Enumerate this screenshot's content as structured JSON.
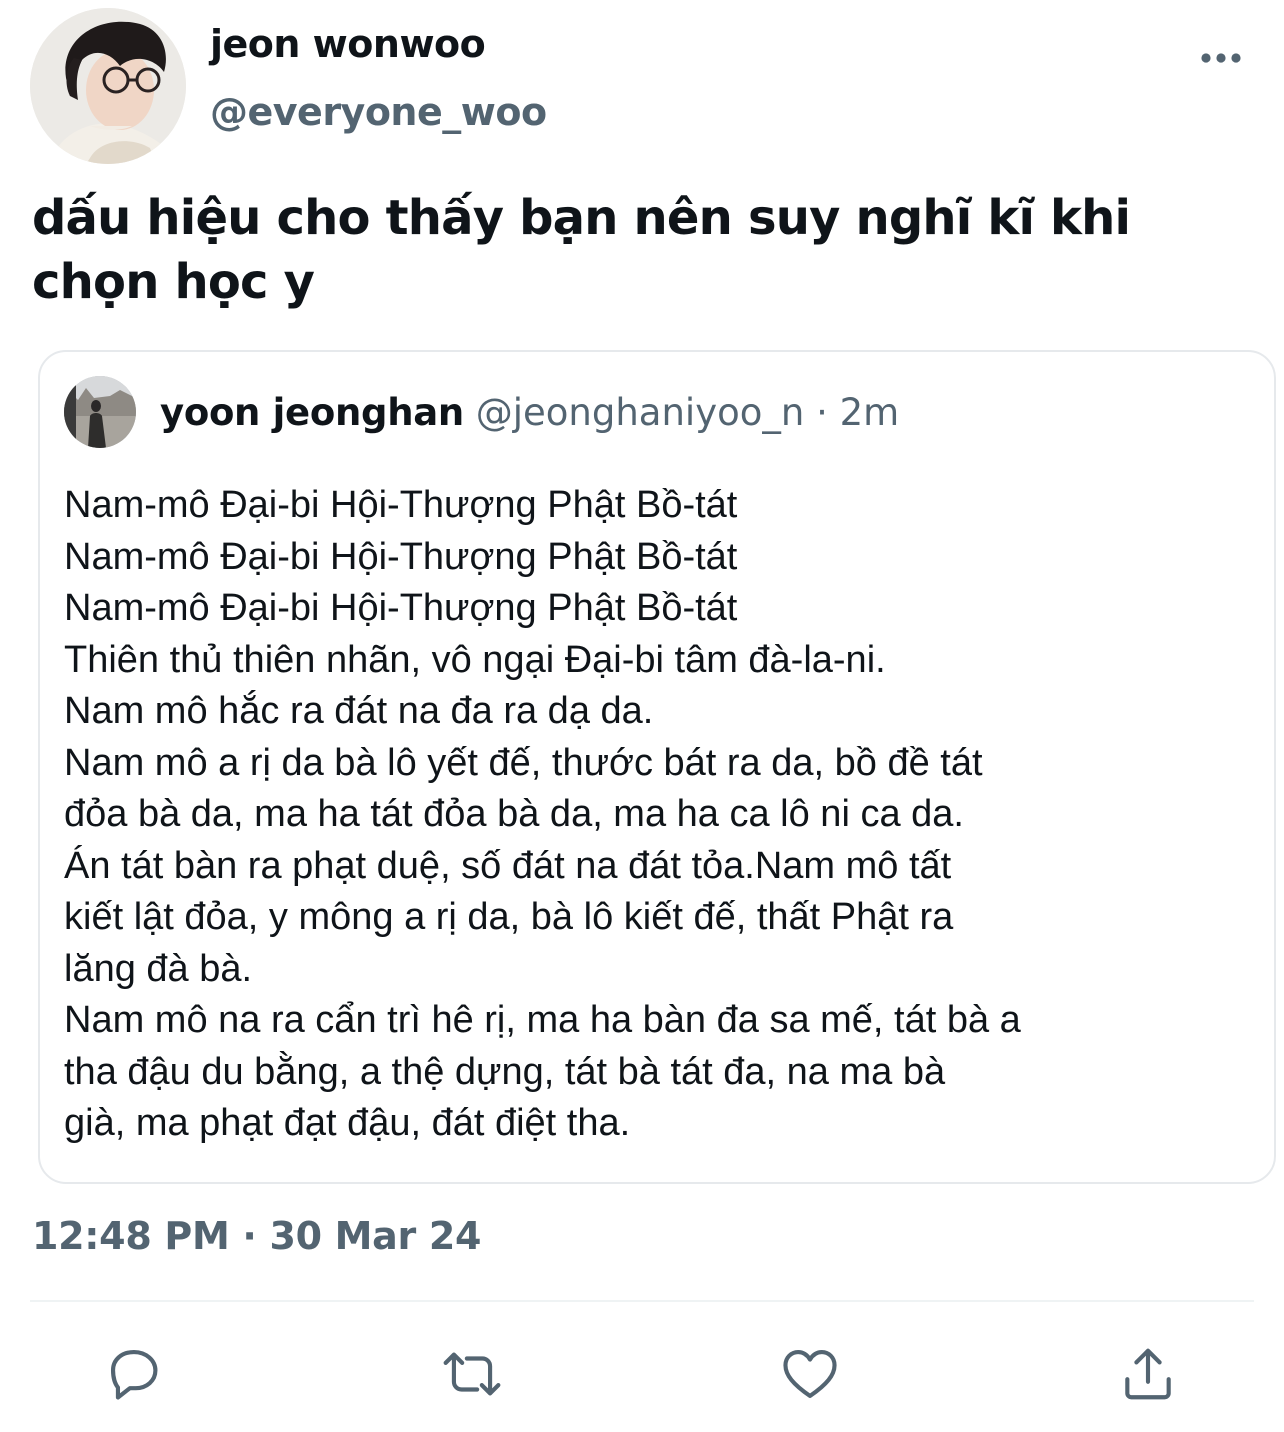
{
  "author": {
    "display_name": "jeon wonwoo",
    "handle": "@everyone_woo"
  },
  "tweet": {
    "text": "dấu hiệu cho thấy bạn nên suy nghĩ kĩ khi chọn học y",
    "timestamp": "12:48 PM · 30 Mar 24"
  },
  "quoted_tweet": {
    "display_name": "yoon jeonghan",
    "handle": "@jeonghaniyoo_n",
    "separator": "·",
    "time": "2m",
    "lines": [
      "Nam-mô Đại-bi Hội-Thượng Phật Bồ-tát",
      "Nam-mô Đại-bi Hội-Thượng Phật Bồ-tát",
      "Nam-mô Đại-bi Hội-Thượng Phật Bồ-tát",
      "Thiên thủ thiên nhãn, vô ngại Đại-bi tâm đà-la-ni.",
      "Nam mô hắc ra đát na đa ra dạ da.",
      "Nam mô a rị da bà lô yết đế, thước bát ra da, bồ đề tát",
      "đỏa bà da, ma ha tát đỏa bà da, ma ha ca lô ni ca da.",
      "Án tát bàn ra phạt duệ, số đát na đát tỏa.Nam mô tất",
      "kiết lật đỏa, y mông a rị da, bà lô kiết đế, thất Phật ra",
      "lăng đà bà.",
      "Nam mô na ra cẩn trì hê rị, ma ha bàn đa sa mế, tát bà a",
      "tha đậu du bằng, a thệ dựng, tát bà tát đa, na ma bà",
      "già, ma phạt đạt đậu, đát điệt tha."
    ]
  },
  "actions": {
    "reply_icon": "reply-icon",
    "retweet_icon": "retweet-icon",
    "like_icon": "heart-icon",
    "share_icon": "share-icon"
  },
  "colors": {
    "text_primary": "#0f1419",
    "text_secondary": "#536471",
    "border": "#e6e9ec"
  }
}
